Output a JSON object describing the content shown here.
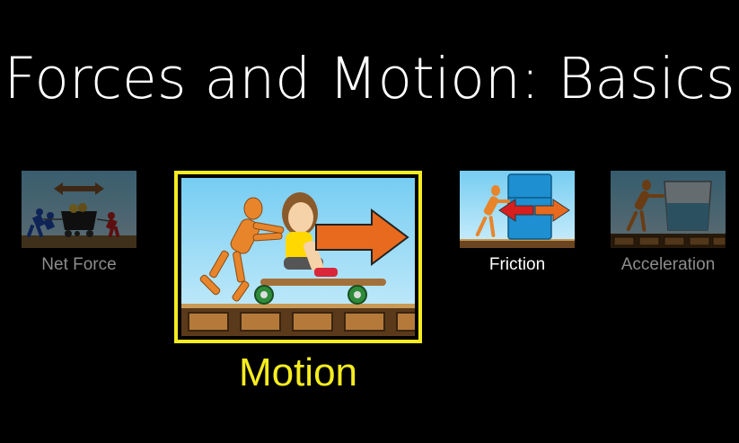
{
  "page": {
    "title": "Forces and Motion: Basics"
  },
  "tiles": {
    "net_force": {
      "label": "Net Force"
    },
    "motion": {
      "label": "Motion"
    },
    "friction": {
      "label": "Friction"
    },
    "acceleration": {
      "label": "Acceleration"
    }
  },
  "colors": {
    "background": "#000000",
    "selected_accent": "#f5ec1f",
    "title_text": "#ffffff",
    "dim_label": "#8c8c8c"
  }
}
